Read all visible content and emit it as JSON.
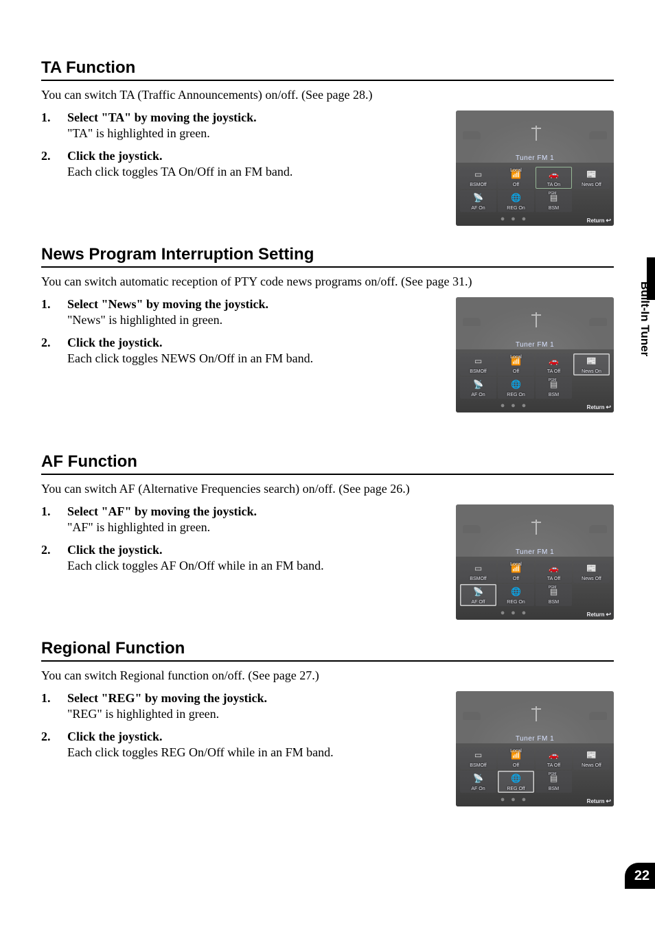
{
  "sideTab": "Built-In Tuner",
  "pageNumber": "22",
  "screenshotCommon": {
    "tunerLabel": "Tuner FM 1",
    "returnLabel": "Return",
    "bsm": "BSM",
    "local": "Local",
    "bsmOff": "BSMOff"
  },
  "sections": [
    {
      "heading": "TA Function",
      "intro": "You can switch TA (Traffic Announcements) on/off. (See page 28.)",
      "steps": [
        {
          "title": "Select \"TA\" by moving the joystick.",
          "desc": "\"TA\" is highlighted in green."
        },
        {
          "title": "Click the joystick.",
          "desc": "Each click toggles TA On/Off in an FM band."
        }
      ],
      "tiles": {
        "localOff": "Off",
        "taLabel": "TA On",
        "newsLabel": "News Off",
        "afLabel": "AF On",
        "regLabel": "REG On",
        "highlight": "ta"
      }
    },
    {
      "heading": "News Program Interruption Setting",
      "intro": "You can switch automatic reception of PTY code news programs on/off. (See page 31.)",
      "steps": [
        {
          "title": "Select \"News\" by moving the joystick.",
          "desc": "\"News\" is highlighted in green."
        },
        {
          "title": "Click the joystick.",
          "desc": "Each click toggles NEWS On/Off in an FM band."
        }
      ],
      "tiles": {
        "localOff": "Off",
        "taLabel": "TA Off",
        "newsLabel": "News On",
        "afLabel": "AF On",
        "regLabel": "REG On",
        "highlight": "news"
      }
    },
    {
      "heading": "AF Function",
      "intro": "You can switch AF (Alternative Frequencies search) on/off. (See page 26.)",
      "steps": [
        {
          "title": "Select \"AF\" by moving the joystick.",
          "desc": "\"AF\" is highlighted in green."
        },
        {
          "title": "Click the joystick.",
          "desc": "Each click toggles AF On/Off while in an FM band."
        }
      ],
      "tiles": {
        "localOff": "Off",
        "taLabel": "TA Off",
        "newsLabel": "News Off",
        "afLabel": "AF Off",
        "regLabel": "REG On",
        "highlight": "af"
      }
    },
    {
      "heading": "Regional Function",
      "intro": "You can switch Regional function on/off. (See page 27.)",
      "steps": [
        {
          "title": "Select \"REG\" by moving the joystick.",
          "desc": "\"REG\" is highlighted in green."
        },
        {
          "title": "Click the joystick.",
          "desc": "Each click toggles REG On/Off while in an FM band."
        }
      ],
      "tiles": {
        "localOff": "Off",
        "taLabel": "TA Off",
        "newsLabel": "News Off",
        "afLabel": "AF On",
        "regLabel": "REG Off",
        "highlight": "reg"
      }
    }
  ]
}
